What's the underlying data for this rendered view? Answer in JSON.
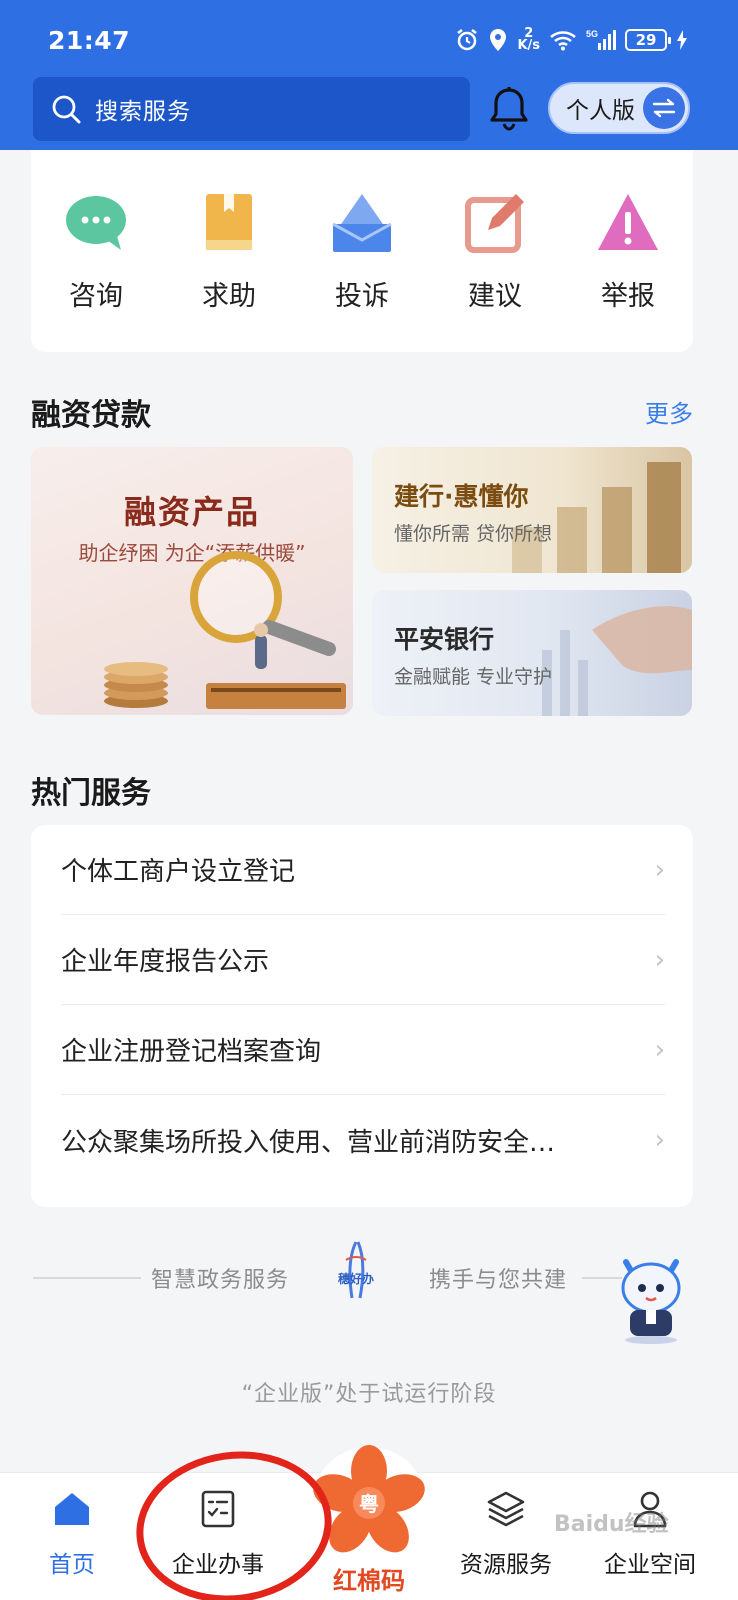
{
  "status_bar": {
    "time": "21:47",
    "net_speed_value": "2",
    "net_speed_unit": "K/s",
    "network_label": "5G",
    "battery_level": "29"
  },
  "header": {
    "search_placeholder": "搜索服务",
    "version_label": "个人版",
    "background_color": "#2f6fe4"
  },
  "quick_services": [
    {
      "label": "咨询",
      "icon": "chat-bubble-icon"
    },
    {
      "label": "求助",
      "icon": "book-icon"
    },
    {
      "label": "投诉",
      "icon": "envelope-icon"
    },
    {
      "label": "建议",
      "icon": "edit-icon"
    },
    {
      "label": "举报",
      "icon": "warning-icon"
    }
  ],
  "financing": {
    "title": "融资贷款",
    "more": "更多",
    "big_card": {
      "title": "融资产品",
      "subtitle": "助企纾困 为企“添薪供暖”"
    },
    "card_ccb": {
      "title": "建行·惠懂你",
      "subtitle": "懂你所需 贷你所想"
    },
    "card_pingan": {
      "title": "平安银行",
      "subtitle": "金融赋能 专业守护"
    }
  },
  "hot_services": {
    "title": "热门服务",
    "items": [
      "个体工商户设立登记",
      "企业年度报告公示",
      "企业注册登记档案查询",
      "公众聚集场所投入使用、营业前消防安全…"
    ]
  },
  "footer": {
    "slogan_left": "智慧政务服务",
    "logo_text": "穗好办",
    "slogan_right": "携手与您共建",
    "trial_note": "“企业版”处于试运行阶段"
  },
  "bottom_nav": {
    "home": "首页",
    "business": "企业办事",
    "center": "红棉码",
    "center_badge": "粤",
    "resources": "资源服务",
    "space": "企业空间",
    "active": "home",
    "accent_color": "#2f6fe4"
  },
  "watermark": "Baidu经验"
}
